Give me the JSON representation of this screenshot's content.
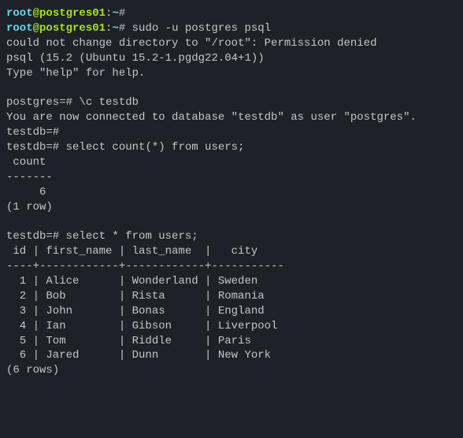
{
  "prompt1": {
    "user": "root",
    "at": "@",
    "host": "postgres01",
    "colon": ":",
    "path": "~",
    "hash": "#"
  },
  "prompt2": {
    "user": "root",
    "at": "@",
    "host": "postgres01",
    "colon": ":",
    "path": "~",
    "hash": "#",
    "command": "sudo -u postgres psql"
  },
  "output": {
    "warning": "could not change directory to \"/root\": Permission denied",
    "version": "psql (15.2 (Ubuntu 15.2-1.pgdg22.04+1))",
    "help": "Type \"help\" for help."
  },
  "psql": {
    "prompt_default": "postgres=#",
    "connect_cmd": "\\c testdb",
    "connected_msg": "You are now connected to database \"testdb\" as user \"postgres\".",
    "prompt_testdb": "testdb=#",
    "query_count": "select count(*) from users;",
    "query_select": "select * from users;"
  },
  "results": {
    "count": {
      "header": " count",
      "divider": "-------",
      "value": "     6",
      "rows": "(1 row)"
    },
    "users": {
      "header": " id | first_name | last_name  |   city",
      "divider": "----+------------+------------+-----------",
      "rows": [
        "  1 | Alice      | Wonderland | Sweden",
        "  2 | Bob        | Rista      | Romania",
        "  3 | John       | Bonas      | England",
        "  4 | Ian        | Gibson     | Liverpool",
        "  5 | Tom        | Riddle     | Paris",
        "  6 | Jared      | Dunn       | New York"
      ],
      "rowcount": "(6 rows)"
    }
  },
  "chart_data": {
    "type": "table",
    "title": "users",
    "columns": [
      "id",
      "first_name",
      "last_name",
      "city"
    ],
    "data": [
      [
        1,
        "Alice",
        "Wonderland",
        "Sweden"
      ],
      [
        2,
        "Bob",
        "Rista",
        "Romania"
      ],
      [
        3,
        "John",
        "Bonas",
        "England"
      ],
      [
        4,
        "Ian",
        "Gibson",
        "Liverpool"
      ],
      [
        5,
        "Tom",
        "Riddle",
        "Paris"
      ],
      [
        6,
        "Jared",
        "Dunn",
        "New York"
      ]
    ]
  }
}
